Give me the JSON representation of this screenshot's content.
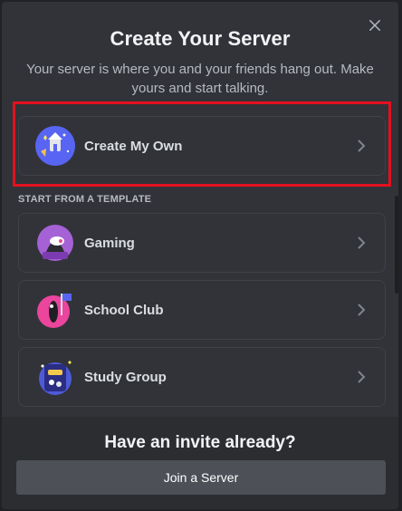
{
  "modal": {
    "title": "Create Your Server",
    "subtitle": "Your server is where you and your friends hang out. Make yours and start talking.",
    "close_icon": "close-icon"
  },
  "create_own": {
    "label": "Create My Own",
    "icon": "server-house-icon",
    "chevron": "chevron-right-icon"
  },
  "template_section": {
    "header": "START FROM A TEMPLATE",
    "items": [
      {
        "label": "Gaming",
        "icon": "gaming-icon"
      },
      {
        "label": "School Club",
        "icon": "school-club-icon"
      },
      {
        "label": "Study Group",
        "icon": "study-group-icon"
      }
    ]
  },
  "footer": {
    "title": "Have an invite already?",
    "join_label": "Join a Server"
  },
  "colors": {
    "background": "#313338",
    "footer": "#2b2d31",
    "highlight": "#e3101f",
    "button": "#4e5058"
  }
}
